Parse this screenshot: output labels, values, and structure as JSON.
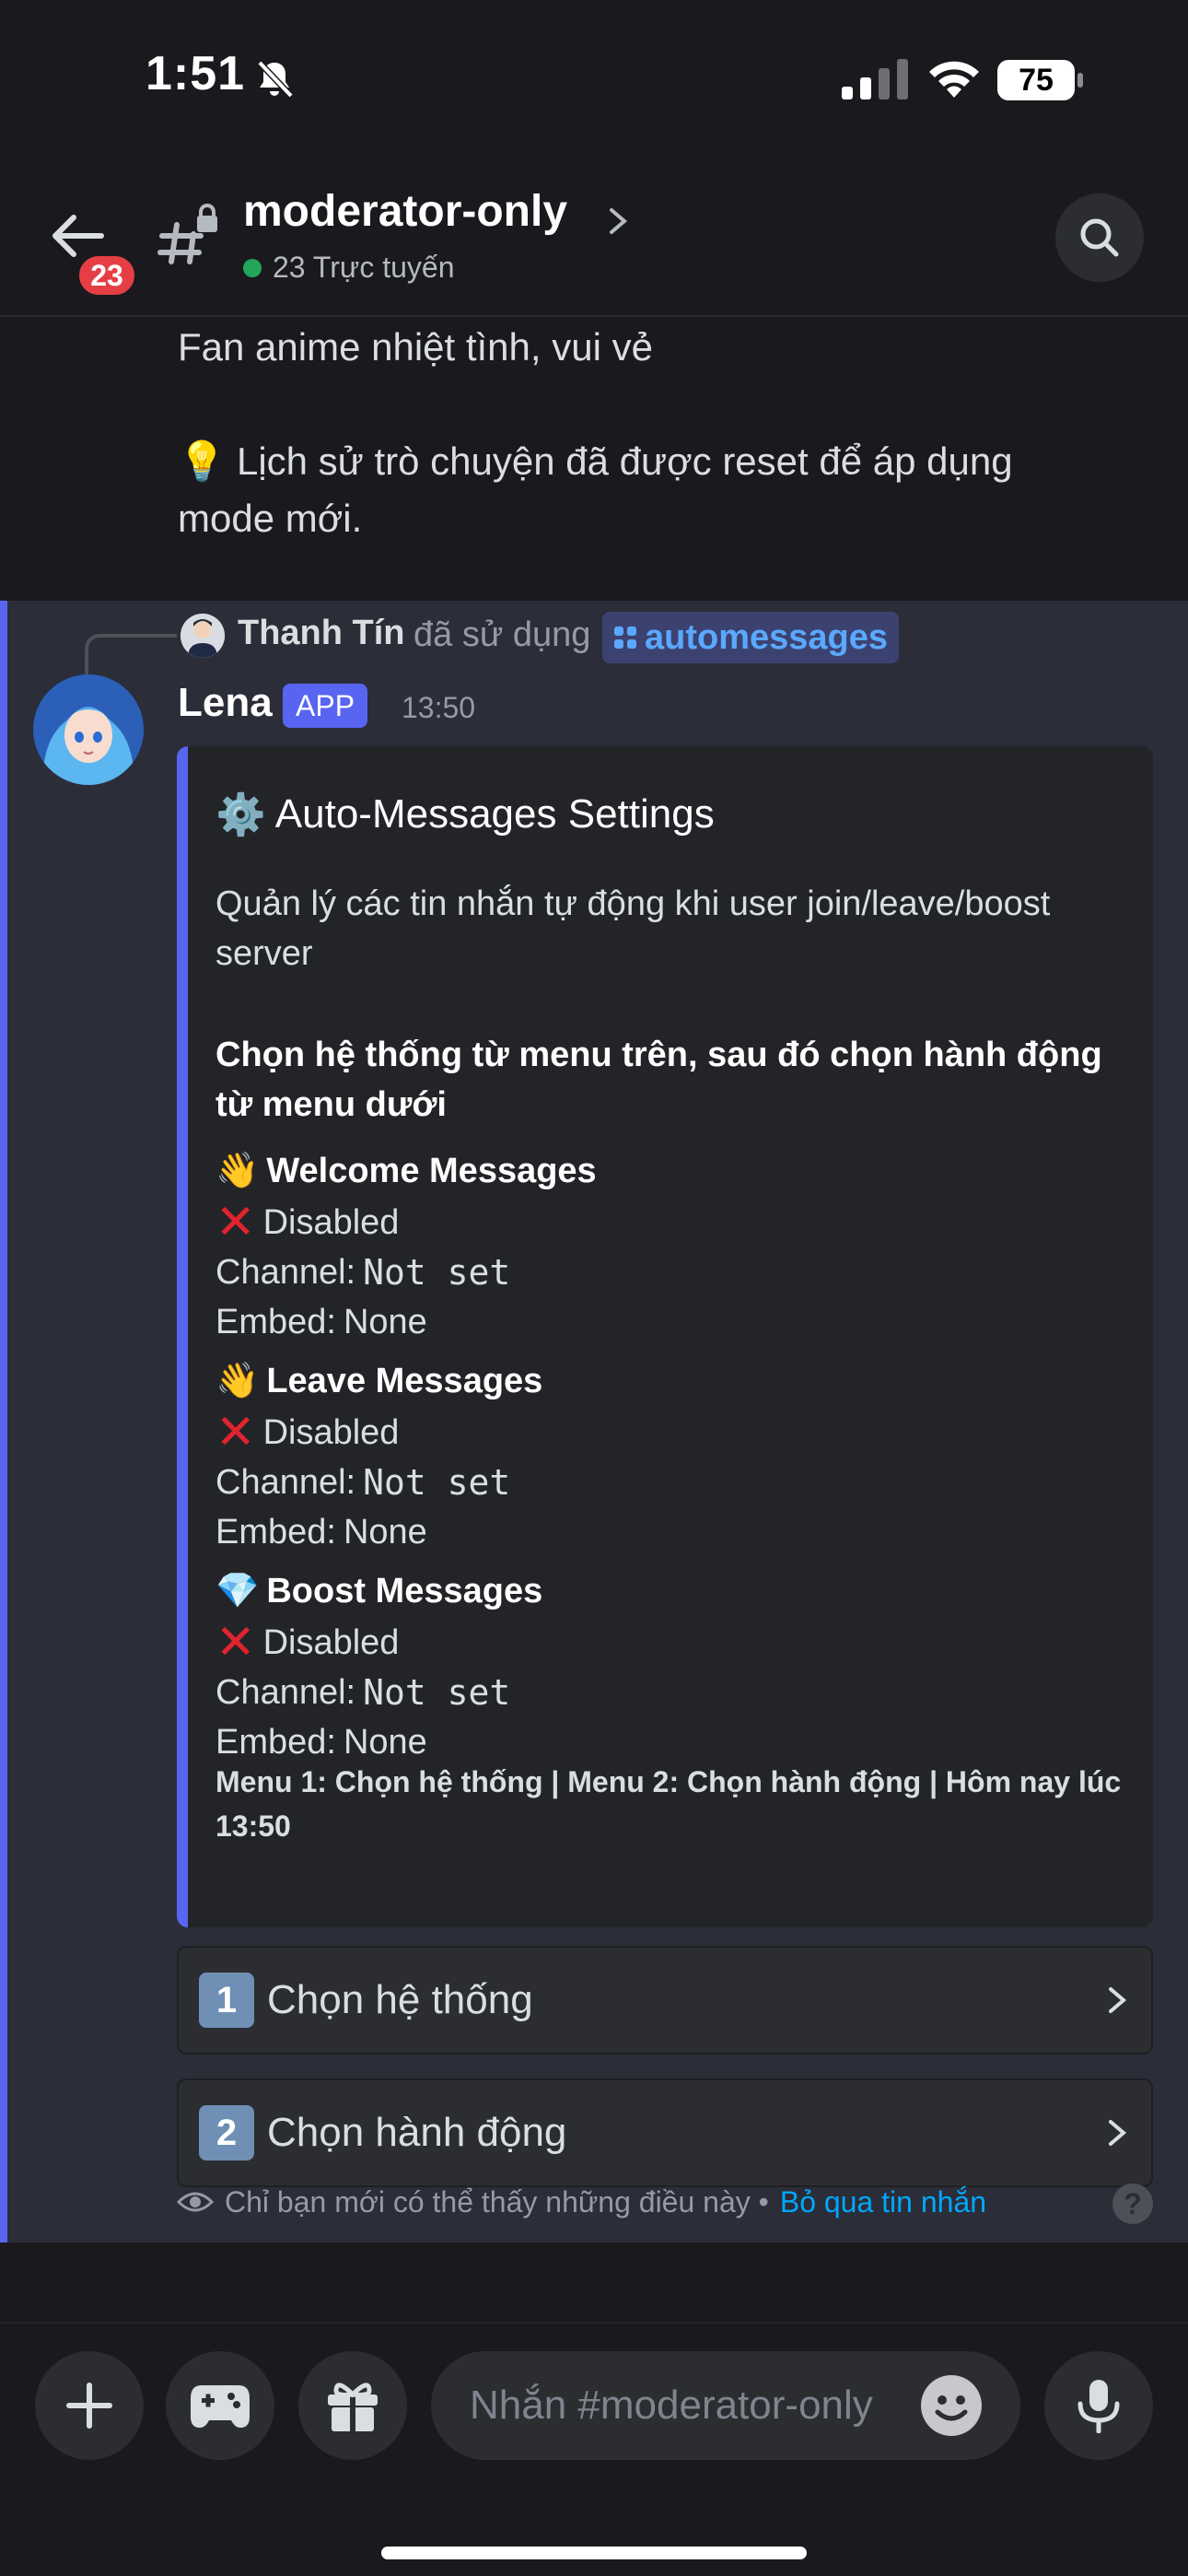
{
  "status_bar": {
    "time": "1:51",
    "battery": "75"
  },
  "header": {
    "unread_count": "23",
    "channel_name": "moderator-only",
    "online_text": "23 Trực tuyến"
  },
  "previous_message": {
    "line1": "Fan anime nhiệt tình, vui vẻ",
    "line2": "💡 Lịch sử trò chuyện đã được reset để áp dụng mode mới."
  },
  "interaction": {
    "user": "Thanh Tín",
    "used_text": "đã sử dụng",
    "command": "automessages"
  },
  "bot_message": {
    "author": "Lena",
    "tag": "APP",
    "time": "13:50",
    "embed": {
      "title_icon": "⚙️",
      "title": "Auto-Messages Settings",
      "description": "Quản lý các tin nhắn tự động khi user join/leave/boost server",
      "instruction": "Chọn hệ thống từ menu trên, sau đó chọn hành động từ menu dưới",
      "fields": [
        {
          "icon": "👋",
          "name": "Welcome Messages",
          "status": "Disabled",
          "channel_label": "Channel:",
          "channel_value": "Not set",
          "embed_label": "Embed:",
          "embed_value": "None"
        },
        {
          "icon": "👋",
          "name": "Leave Messages",
          "status": "Disabled",
          "channel_label": "Channel:",
          "channel_value": "Not set",
          "embed_label": "Embed:",
          "embed_value": "None"
        },
        {
          "icon": "💎",
          "name": "Boost Messages",
          "status": "Disabled",
          "channel_label": "Channel:",
          "channel_value": "Not set",
          "embed_label": "Embed:",
          "embed_value": "None"
        }
      ],
      "footer": "Menu 1: Chọn hệ thống | Menu 2: Chọn hành động | Hôm nay lúc 13:50"
    },
    "menus": [
      {
        "number": "1",
        "label": "Chọn hệ thống"
      },
      {
        "number": "2",
        "label": "Chọn hành động"
      }
    ],
    "ephemeral_note": "Chỉ bạn mới có thể thấy những điều này •",
    "dismiss_label": "Bỏ qua tin nhắn",
    "help_symbol": "?"
  },
  "composer": {
    "placeholder": "Nhắn #moderator-only"
  },
  "colors": {
    "accent": "#5865f2",
    "online": "#23a55a",
    "badge": "#e53f45",
    "link": "#00a8fc"
  }
}
